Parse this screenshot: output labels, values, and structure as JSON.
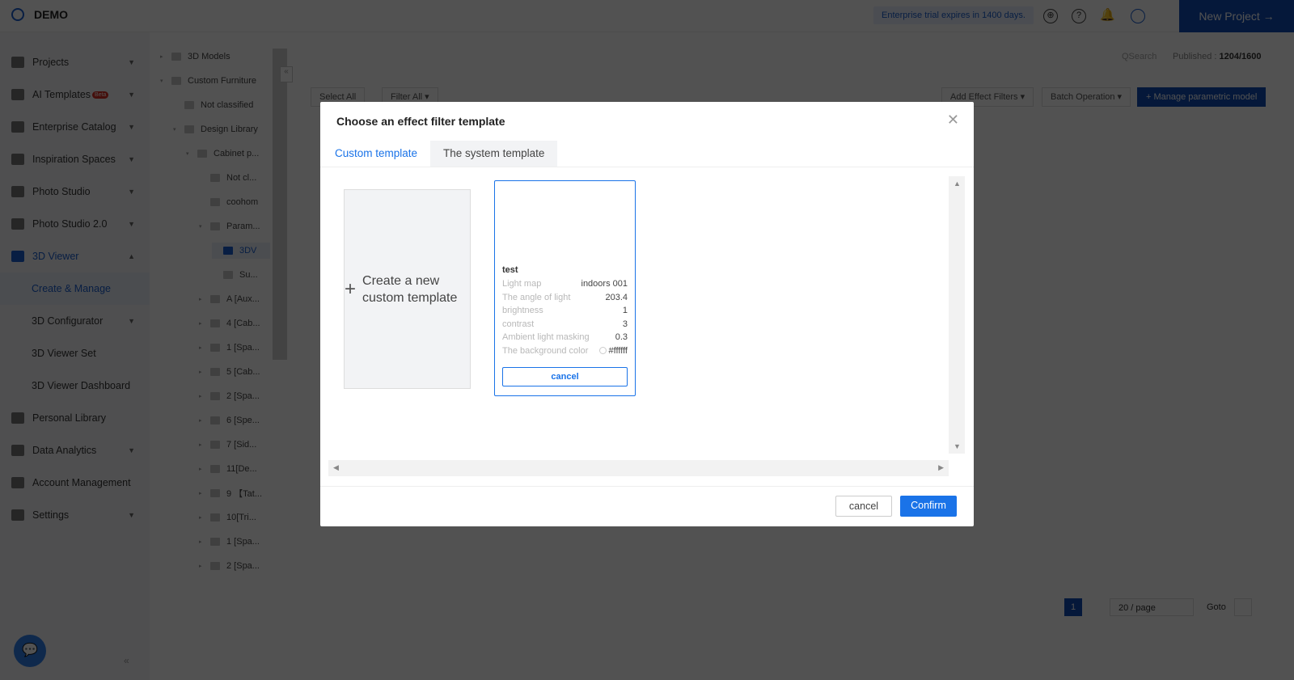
{
  "header": {
    "brand": "DEMO",
    "trial": "Enterprise trial expires in 1400 days.",
    "new_project": "New Project →"
  },
  "sidebar": {
    "items": [
      {
        "label": "Projects"
      },
      {
        "label": "AI Templates",
        "badge": "Beta"
      },
      {
        "label": "Enterprise Catalog"
      },
      {
        "label": "Inspiration Spaces"
      },
      {
        "label": "Photo Studio"
      },
      {
        "label": "Photo Studio 2.0"
      },
      {
        "label": "3D Viewer"
      },
      {
        "label": "Create & Manage"
      },
      {
        "label": "3D Configurator"
      },
      {
        "label": "3D Viewer Set"
      },
      {
        "label": "3D Viewer Dashboard"
      },
      {
        "label": "Personal Library"
      },
      {
        "label": "Data Analytics"
      },
      {
        "label": "Account Management"
      },
      {
        "label": "Settings"
      }
    ]
  },
  "tree": [
    "3D Models",
    "Custom Furniture",
    "Not classified",
    "Design Library",
    "Cabinet p...",
    "Not cl...",
    "coohom",
    "Param...",
    "3DV",
    "Su...",
    "A [Aux...",
    "4 [Cab...",
    "1 [Spa...",
    "5 [Cab...",
    "2 [Spa...",
    "6 [Spe...",
    "7 [Sid...",
    "11[De...",
    "9 【Tat...",
    "10[Tri...",
    "1 [Spa...",
    "2 [Spa..."
  ],
  "toolbar": {
    "search": "QSearch",
    "published_label": "Published : ",
    "published": "1204/1600",
    "select_all": "Select All",
    "filter_all": "Filter All ▾",
    "add_effect": "Add Effect Filters ▾",
    "batch": "Batch Operation ▾",
    "manage": "+ Manage parametric model"
  },
  "pagination": {
    "page": "1",
    "per_page": "20 / page",
    "goto": "Goto"
  },
  "modal": {
    "title": "Choose an effect filter template",
    "tabs": [
      "Custom template",
      "The system template"
    ],
    "new_template": "Create a new custom template",
    "card": {
      "name": "test",
      "rows": [
        {
          "k": "Light map",
          "v": "indoors 001"
        },
        {
          "k": "The angle of light",
          "v": "203.4"
        },
        {
          "k": "brightness",
          "v": "1"
        },
        {
          "k": "contrast",
          "v": "3"
        },
        {
          "k": "Ambient light masking",
          "v": "0.3"
        },
        {
          "k": "The background color",
          "v": "#ffffff"
        }
      ],
      "cancel": "cancel"
    },
    "cancel": "cancel",
    "confirm": "Confirm"
  }
}
